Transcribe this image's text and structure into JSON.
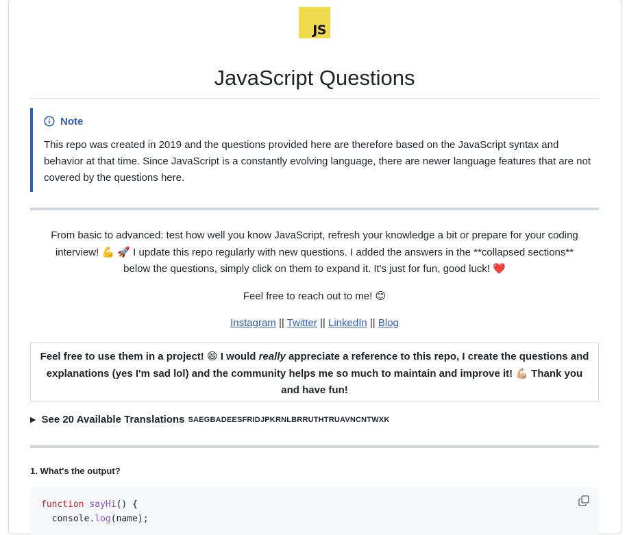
{
  "logo": {
    "text": "JS",
    "bg": "#f0db4f"
  },
  "title": "JavaScript Questions",
  "note": {
    "label": "Note",
    "icon": "info-icon",
    "text": "This repo was created in 2019 and the questions provided here are therefore based on the JavaScript syntax and behavior at that time. Since JavaScript is a constantly evolving language, there are newer language features that are not covered by the questions here."
  },
  "intro": {
    "line1": "From basic to advanced: test how well you know JavaScript, refresh your knowledge a bit or prepare for your coding",
    "line2": "interview! 💪 🚀 I update this repo regularly with new questions. I added the answers in the **collapsed sections**",
    "line3": "below the questions, simply click on them to expand it. It's just for fun, good luck! ❤️"
  },
  "reach_out": "Feel free to reach out to me! 😊",
  "links": {
    "instagram": "Instagram",
    "twitter": "Twitter",
    "linkedin": "LinkedIn",
    "blog": "Blog",
    "separator": "||"
  },
  "project_box": {
    "part1": "Feel free to use them in a project! 😄 I would ",
    "emphasis": "really",
    "part2": " appreciate a reference to this repo, I create the questions and explanations (yes I'm sad lol) and the community helps me so much to maintain and improve it! 💪🏼 Thank you and have fun!"
  },
  "translations": {
    "label": "See 20 Available Translations",
    "flags": "SAEGBADEESFRIDJPKRNLBRRUTHTRUAVNCNTWXK"
  },
  "question": {
    "label": "1. What's the output?",
    "code": {
      "line1_kw": "function",
      "line1_fn": "sayHi",
      "line1_rest": "() {",
      "line2": "  console.",
      "line2_fn": "log",
      "line2_rest": "(name);"
    }
  },
  "colors": {
    "accent": "#2f5bb7",
    "keyword": "#cf222e",
    "function": "#8250df"
  }
}
